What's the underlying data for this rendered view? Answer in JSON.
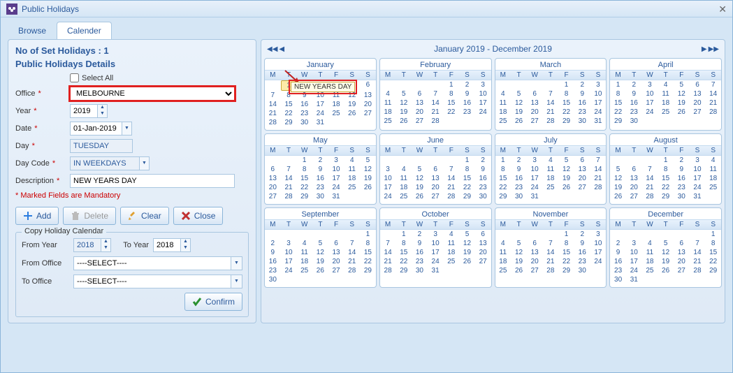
{
  "window": {
    "title": "Public Holidays"
  },
  "tabs": {
    "browse": "Browse",
    "calender": "Calender"
  },
  "left": {
    "no_of_set": "No of Set Holidays : 1",
    "details_title": "Public Holidays Details",
    "select_all": "Select All",
    "labels": {
      "office": "Office",
      "year": "Year",
      "date": "Date",
      "day": "Day",
      "daycode": "Day Code",
      "desc": "Description"
    },
    "office_value": "MELBOURNE",
    "year_value": "2019",
    "date_value": "01-Jan-2019",
    "day_value": "TUESDAY",
    "daycode_value": "IN WEEKDAYS",
    "desc_value": "NEW YEARS DAY",
    "mandatory": "* Marked Fields are Mandatory",
    "buttons": {
      "add": "Add",
      "delete": "Delete",
      "clear": "Clear",
      "close": "Close"
    },
    "copy": {
      "legend": "Copy Holiday Calendar",
      "from_year": "From Year",
      "from_year_value": "2018",
      "to_year": "To Year",
      "to_year_value": "2018",
      "from_office": "From Office",
      "from_office_value": "----SELECT----",
      "to_office": "To Office",
      "to_office_value": "----SELECT----",
      "confirm": "Confirm"
    }
  },
  "cal": {
    "range": "January 2019 - December 2019",
    "dow": [
      "M",
      "T",
      "W",
      "T",
      "F",
      "S",
      "S"
    ],
    "months": [
      {
        "name": "January",
        "lead": 1,
        "days": 31
      },
      {
        "name": "February",
        "lead": 4,
        "days": 28
      },
      {
        "name": "March",
        "lead": 4,
        "days": 31
      },
      {
        "name": "April",
        "lead": 0,
        "days": 30
      },
      {
        "name": "May",
        "lead": 2,
        "days": 31
      },
      {
        "name": "June",
        "lead": 5,
        "days": 30
      },
      {
        "name": "July",
        "lead": 0,
        "days": 31
      },
      {
        "name": "August",
        "lead": 3,
        "days": 31
      },
      {
        "name": "September",
        "lead": 6,
        "days": 30
      },
      {
        "name": "October",
        "lead": 1,
        "days": 31
      },
      {
        "name": "November",
        "lead": 4,
        "days": 30
      },
      {
        "name": "December",
        "lead": 6,
        "days": 31
      }
    ],
    "selected": {
      "month": 0,
      "day": 1
    },
    "tooltip": "NEW YEARS DAY"
  }
}
